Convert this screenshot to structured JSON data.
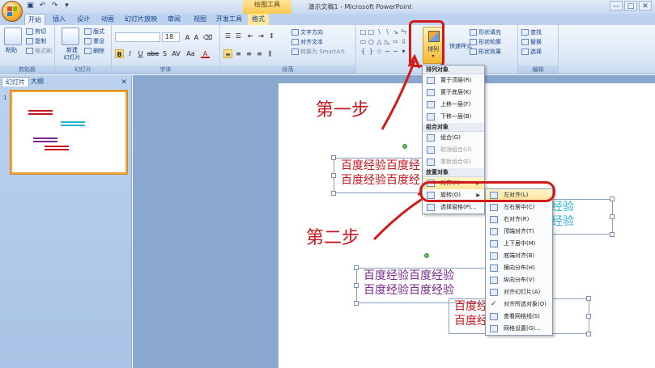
{
  "titlebar": {
    "title": "演示文稿1 - Microsoft PowerPoint",
    "context_tool": "绘图工具",
    "controls": [
      "—",
      "□",
      "✕"
    ]
  },
  "tabs": [
    "开始",
    "插入",
    "设计",
    "动画",
    "幻灯片放映",
    "审阅",
    "视图",
    "开发工具",
    "格式"
  ],
  "ribbon": {
    "clipboard": {
      "paste": "粘贴",
      "cut": "剪切",
      "copy": "复制",
      "format_painter": "格式刷",
      "label": "剪贴板"
    },
    "slides": {
      "new_slide": "新建\n幻灯片",
      "layout": "版式",
      "reset": "重设",
      "delete": "删除",
      "label": "幻灯片"
    },
    "font": {
      "size": "18",
      "label": "字体",
      "bold": "B",
      "italic": "I",
      "underline": "U",
      "strike": "abe",
      "shadow": "S",
      "spacing": "AV",
      "case": "Aa",
      "color": "A"
    },
    "paragraph": {
      "text_direction": "文字方向",
      "align_text": "对齐文本",
      "smartart": "转换为 SmartArt",
      "label": "段落"
    },
    "drawing": {
      "arrange": "排列",
      "quick_styles": "快速样式",
      "fill": "形状填充",
      "outline": "形状轮廓",
      "effects": "形状效果"
    },
    "editing": {
      "find": "查找",
      "replace": "替换",
      "select": "选择",
      "label": "编辑"
    }
  },
  "left_pane": {
    "tabs": [
      "幻灯片",
      "大纲"
    ],
    "close": "✕",
    "slide_number": "1"
  },
  "slide": {
    "text_line": "百度经验百度经验",
    "box1_lines": [
      "百度经验百度经",
      "百度经验百度经"
    ],
    "box2_lines": [
      "百度经验百度经验",
      "百度经验百度经验"
    ],
    "box3_lines": [
      "经验",
      "经验"
    ],
    "box4_lines": [
      "百度经",
      "百度经"
    ]
  },
  "annotations": {
    "step1": "第一步",
    "step2": "第二步"
  },
  "arrange_menu": {
    "sections": [
      {
        "head": "排列对象",
        "items": [
          {
            "label": "置于顶层(R)",
            "disabled": false
          },
          {
            "label": "置于底层(K)",
            "disabled": false
          },
          {
            "label": "上移一层(F)",
            "disabled": false
          },
          {
            "label": "下移一层(B)",
            "disabled": false
          }
        ]
      },
      {
        "head": "组合对象",
        "items": [
          {
            "label": "组合(G)",
            "disabled": false
          },
          {
            "label": "取消组合(U)",
            "disabled": true
          },
          {
            "label": "重新组合(E)",
            "disabled": true
          }
        ]
      },
      {
        "head": "放置对象",
        "items": [
          {
            "label": "对齐(A)",
            "disabled": false,
            "submenu": true,
            "highlight": true
          },
          {
            "label": "旋转(O)",
            "disabled": false,
            "submenu": true
          },
          {
            "label": "选择窗格(P)...",
            "disabled": false
          }
        ]
      }
    ]
  },
  "align_menu": {
    "items": [
      {
        "label": "左对齐(L)",
        "highlight": true
      },
      {
        "label": "左右居中(C)"
      },
      {
        "label": "右对齐(R)"
      },
      {
        "label": "顶端对齐(T)"
      },
      {
        "label": "上下居中(M)"
      },
      {
        "label": "底端对齐(B)"
      },
      {
        "label": "横向分布(H)"
      },
      {
        "label": "纵向分布(V)"
      },
      {
        "label": "对齐幻灯片(A)"
      },
      {
        "label": "对齐所选对象(O)",
        "checked": true
      },
      {
        "label": "查看网格线(S)"
      },
      {
        "label": "网格设置(G)..."
      }
    ]
  },
  "colors": {
    "red_text": "#c4161c",
    "cyan_text": "#2bb3d4",
    "purple_text": "#7a2a8c",
    "highlight_box": "#d21a1a"
  }
}
